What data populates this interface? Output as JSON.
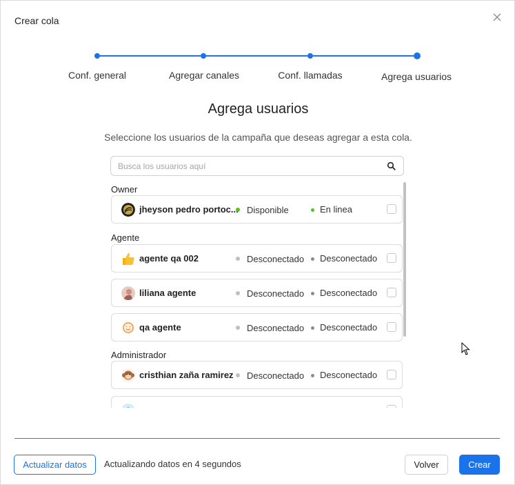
{
  "dialog": {
    "title": "Crear cola",
    "close_icon": "close-icon"
  },
  "stepper": {
    "steps": [
      {
        "label": "Conf. general"
      },
      {
        "label": "Agregar canales"
      },
      {
        "label": "Conf. llamadas"
      },
      {
        "label": "Agrega usuarios"
      }
    ],
    "active_color": "#1a73e8"
  },
  "content": {
    "heading": "Agrega usuarios",
    "subtitle": "Seleccione los usuarios de la campaña que deseas agregar a esta cola.",
    "search": {
      "placeholder": "Busca los usuarios aquí",
      "icon": "search-icon"
    }
  },
  "groups": [
    {
      "label": "Owner",
      "users": [
        {
          "name": "jheyson pedro portoc...",
          "avatar": "avatar-owner",
          "status": "Disponible",
          "status_color": "#52c41a",
          "connection": "En linea",
          "connection_color": "#52c41a",
          "checked": false
        }
      ]
    },
    {
      "label": "Agente",
      "users": [
        {
          "name": "agente qa 002",
          "avatar": "thumbs-up-avatar",
          "status": "Desconectado",
          "status_color": "#bfbfbf",
          "connection": "Desconectado",
          "connection_color": "#8c8c8c",
          "checked": false
        },
        {
          "name": "liliana agente",
          "avatar": "photo-avatar",
          "status": "Desconectado",
          "status_color": "#bfbfbf",
          "connection": "Desconectado",
          "connection_color": "#8c8c8c",
          "checked": false
        },
        {
          "name": "qa agente",
          "avatar": "smiley-avatar",
          "status": "Desconectado",
          "status_color": "#bfbfbf",
          "connection": "Desconectado",
          "connection_color": "#8c8c8c",
          "checked": false
        }
      ]
    },
    {
      "label": "Administrador",
      "users": [
        {
          "name": "cristhian zaña ramirez",
          "avatar": "monkey-avatar",
          "status": "Desconectado",
          "status_color": "#bfbfbf",
          "connection": "Desconectado",
          "connection_color": "#8c8c8c",
          "checked": false
        }
      ]
    }
  ],
  "footer": {
    "refresh_label": "Actualizar datos",
    "refresh_status": "Actualizando datos en 4 segundos",
    "back_label": "Volver",
    "create_label": "Crear"
  }
}
